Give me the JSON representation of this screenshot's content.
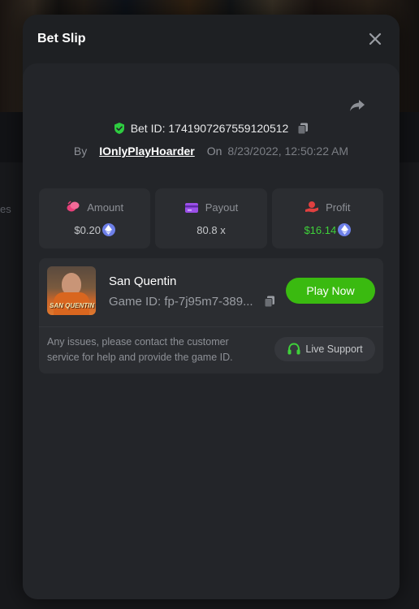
{
  "background": {
    "side_text": "es"
  },
  "modal": {
    "title": "Bet Slip",
    "close_icon": "close-icon"
  },
  "bet": {
    "bet_id_label": "Bet ID: 1741907267559120512",
    "by_label": "By",
    "username": "IOnlyPlayHoarder",
    "on_label": "On",
    "date": "8/23/2022, 12:50:22 AM"
  },
  "stats": [
    {
      "label": "Amount",
      "value": "$0.20",
      "icon": "coins-icon",
      "currency_icon": "eth-icon",
      "color": "#e8407a"
    },
    {
      "label": "Payout",
      "value": "80.8 x",
      "icon": "card-icon",
      "color": "#9b4fe8"
    },
    {
      "label": "Profit",
      "value": "$16.14",
      "icon": "hand-coin-icon",
      "currency_icon": "eth-icon",
      "color": "#e04040",
      "value_color": "#3fd13a"
    }
  ],
  "game": {
    "name": "San Quentin",
    "game_id": "Game ID: fp-7j95m7-389...",
    "play_label": "Play Now",
    "thumb_logo": "SAN QUENTIN",
    "help_text": "Any issues, please contact the customer service for help and provide the game ID.",
    "support_label": "Live Support"
  },
  "colors": {
    "accent_green": "#3aba10",
    "shield_green": "#2ecc40",
    "eth_blue": "#6d7fe8"
  }
}
